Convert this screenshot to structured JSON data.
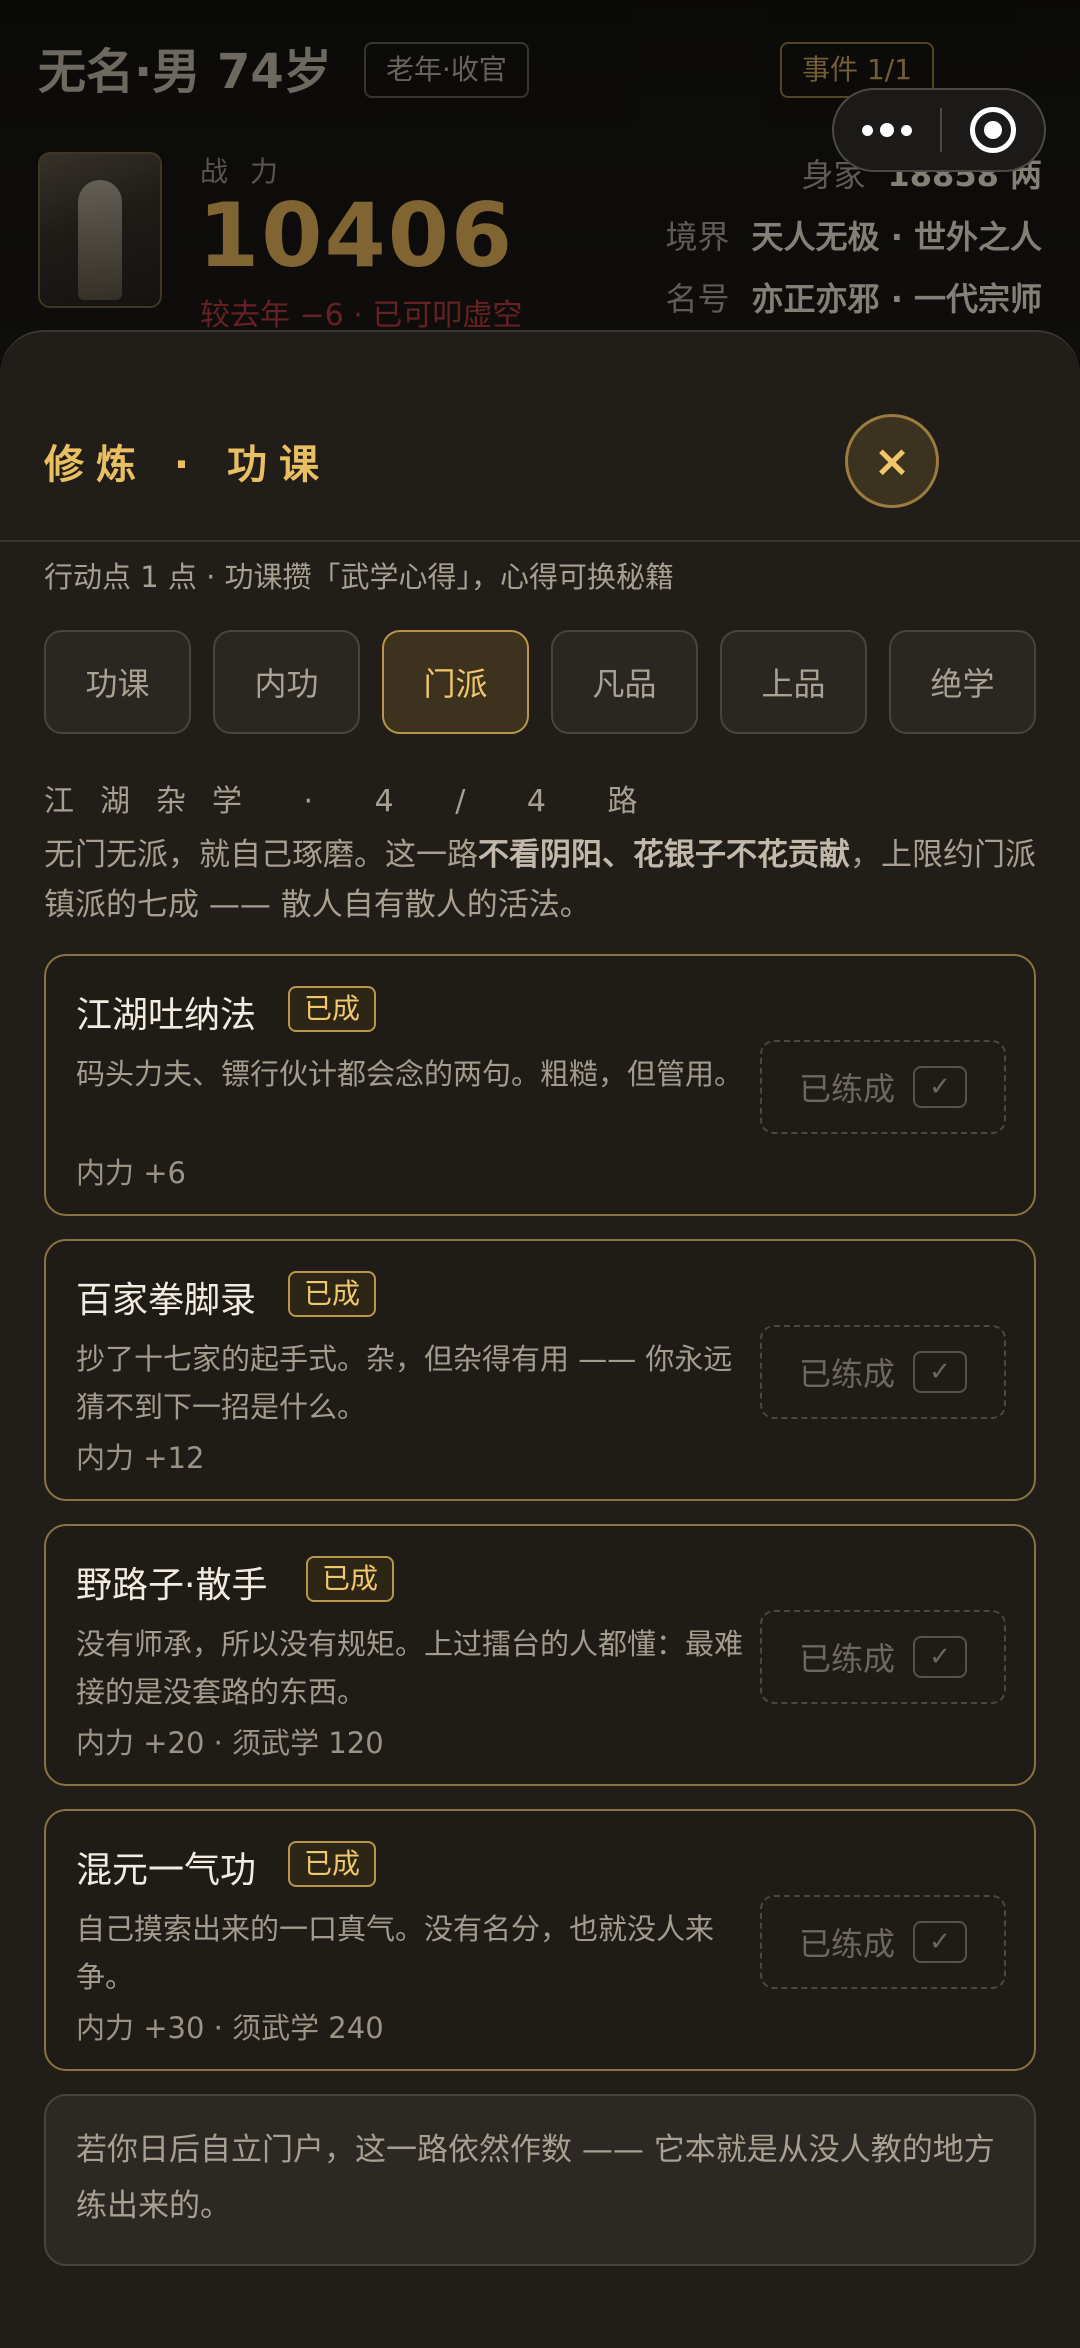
{
  "background": {
    "title": "无名·男 74岁",
    "tag": "老年·收官",
    "event": "事件 1/1",
    "power_label": "战力",
    "power_value": "10406",
    "power_sub": "较去年 −6 · 已可叩虚空",
    "wealth_label": "身家",
    "wealth_value": "18858 两",
    "realm_label": "境界",
    "realm_value": "天人无极 · 世外之人",
    "fame_label": "名号",
    "fame_value": "亦正亦邪 · 一代宗师"
  },
  "sheet": {
    "title": "修炼 · 功课",
    "close_label": "×",
    "hint": "行动点 1 点 · 功课攒「武学心得」，心得可换秘籍",
    "tabs": [
      "功课",
      "内功",
      "门派",
      "凡品",
      "上品",
      "绝学"
    ],
    "active_tab": "门派",
    "section_title": "江湖杂学 · 4 / 4 路",
    "section_desc": {
      "part1": "无门无派，就自己琢磨。这一路",
      "bold": "不看阴阳、花银子不花贡献",
      "part2": "，上限约门派镇派的七成 —— 散人自有散人的活法。"
    },
    "cards": [
      {
        "name": "江湖吐纳法",
        "badge": "已成",
        "desc": "码头力夫、镖行伙计都会念的两句。粗糙，但管用。",
        "stat": "内力 +6",
        "done": "已练成",
        "check": "✓"
      },
      {
        "name": "百家拳脚录",
        "badge": "已成",
        "desc": "抄了十七家的起手式。杂，但杂得有用 —— 你永远猜不到下一招是什么。",
        "stat": "内力 +12",
        "done": "已练成",
        "check": "✓"
      },
      {
        "name": "野路子·散手",
        "badge": "已成",
        "desc": "没有师承，所以没有规矩。上过擂台的人都懂：最难接的是没套路的东西。",
        "stat": "内力 +20 · 须武学 120",
        "done": "已练成",
        "check": "✓"
      },
      {
        "name": "混元一气功",
        "badge": "已成",
        "desc": "自己摸索出来的一口真气。没有名分，也就没人来争。",
        "stat": "内力 +30 · 须武学 240",
        "done": "已练成",
        "check": "✓"
      }
    ],
    "note": "若你日后自立门户，这一路依然作数 —— 它本就是从没人教的地方练出来的。"
  }
}
